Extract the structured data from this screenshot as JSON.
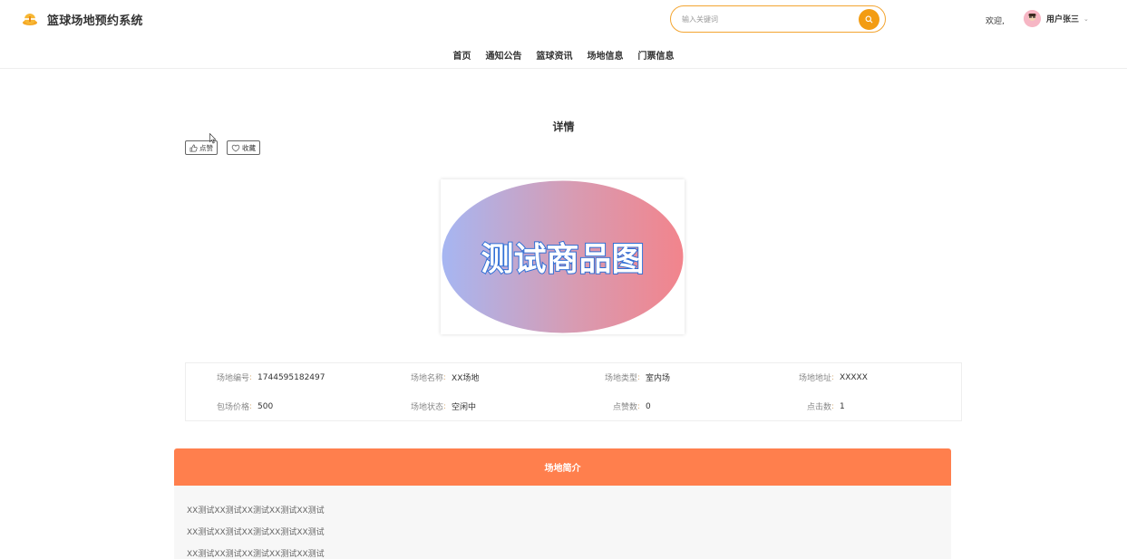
{
  "header": {
    "title": "篮球场地预约系统",
    "search_placeholder": "输入关键词",
    "welcome": "欢迎,",
    "username": "用户张三"
  },
  "nav": {
    "items": [
      {
        "label": "首页"
      },
      {
        "label": "通知公告"
      },
      {
        "label": "篮球资讯"
      },
      {
        "label": "场地信息"
      },
      {
        "label": "门票信息"
      }
    ]
  },
  "detail": {
    "title": "详情",
    "like_label": "点赞",
    "favorite_label": "收藏",
    "image_text": "测试商品图"
  },
  "info": {
    "code": {
      "label": "场地编号",
      "value": "1744595182497"
    },
    "name": {
      "label": "场地名称",
      "value": "XX场地"
    },
    "type": {
      "label": "场地类型",
      "value": "室内场"
    },
    "address": {
      "label": "场地地址",
      "value": "XXXXX"
    },
    "price": {
      "label": "包场价格",
      "value": "500"
    },
    "status": {
      "label": "场地状态",
      "value": "空闲中"
    },
    "likes": {
      "label": "点赞数",
      "value": "0"
    },
    "clicks": {
      "label": "点击数",
      "value": "1"
    }
  },
  "intro": {
    "title": "场地简介",
    "lines": [
      "XX测试XX测试XX测试XX测试XX测试",
      "XX测试XX测试XX测试XX测试XX测试",
      "XX测试XX测试XX测试XX测试XX测试"
    ]
  },
  "colors": {
    "accent": "#f39c12",
    "intro_header": "#ff7f4d"
  }
}
